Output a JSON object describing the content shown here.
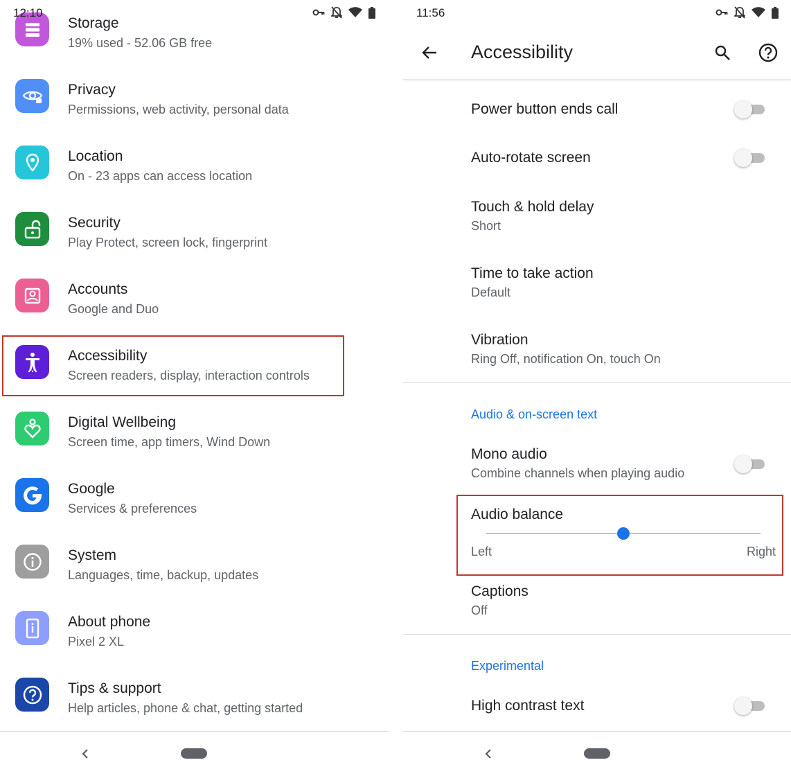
{
  "left_screen": {
    "status_time": "12:10",
    "items": [
      {
        "title": "Storage",
        "subtitle": "19% used - 52.06 GB free",
        "icon": "storage-icon",
        "color": "#c158dc"
      },
      {
        "title": "Privacy",
        "subtitle": "Permissions, web activity, personal data",
        "icon": "eye-icon",
        "color": "#4f8ff7"
      },
      {
        "title": "Location",
        "subtitle": "On - 23 apps can access location",
        "icon": "location-pin-icon",
        "color": "#26c6da"
      },
      {
        "title": "Security",
        "subtitle": "Play Protect, screen lock, fingerprint",
        "icon": "unlock-icon",
        "color": "#1e8e3e"
      },
      {
        "title": "Accounts",
        "subtitle": "Google and Duo",
        "icon": "account-box-icon",
        "color": "#ec5f92"
      },
      {
        "title": "Accessibility",
        "subtitle": "Screen readers, display, interaction controls",
        "icon": "accessibility-icon",
        "color": "#5e1fd8"
      },
      {
        "title": "Digital Wellbeing",
        "subtitle": "Screen time, app timers, Wind Down",
        "icon": "wellbeing-heart-icon",
        "color": "#2ecc71"
      },
      {
        "title": "Google",
        "subtitle": "Services & preferences",
        "icon": "google-g-icon",
        "color": "#1a73e8"
      },
      {
        "title": "System",
        "subtitle": "Languages, time, backup, updates",
        "icon": "info-icon",
        "color": "#9e9e9e"
      },
      {
        "title": "About phone",
        "subtitle": "Pixel 2 XL",
        "icon": "phone-info-icon",
        "color": "#8c9eff"
      },
      {
        "title": "Tips & support",
        "subtitle": "Help articles, phone & chat, getting started",
        "icon": "help-icon",
        "color": "#1a47a8"
      }
    ]
  },
  "right_screen": {
    "status_time": "11:56",
    "app_bar": {
      "title": "Accessibility"
    },
    "rows": {
      "power_button": {
        "title": "Power button ends call",
        "toggle": false
      },
      "auto_rotate": {
        "title": "Auto-rotate screen",
        "toggle": false
      },
      "touch_hold": {
        "title": "Touch & hold delay",
        "subtitle": "Short"
      },
      "time_action": {
        "title": "Time to take action",
        "subtitle": "Default"
      },
      "vibration": {
        "title": "Vibration",
        "subtitle": "Ring Off, notification On, touch On"
      },
      "section_audio": "Audio & on-screen text",
      "mono_audio": {
        "title": "Mono audio",
        "subtitle": "Combine channels when playing audio",
        "toggle": false
      },
      "audio_balance": {
        "title": "Audio balance",
        "left_label": "Left",
        "right_label": "Right",
        "value": 0.5
      },
      "captions": {
        "title": "Captions",
        "subtitle": "Off"
      },
      "section_experimental": "Experimental",
      "high_contrast": {
        "title": "High contrast text",
        "toggle": false
      }
    }
  },
  "colors": {
    "accent": "#1a73e8",
    "highlight": "#c0392b"
  }
}
